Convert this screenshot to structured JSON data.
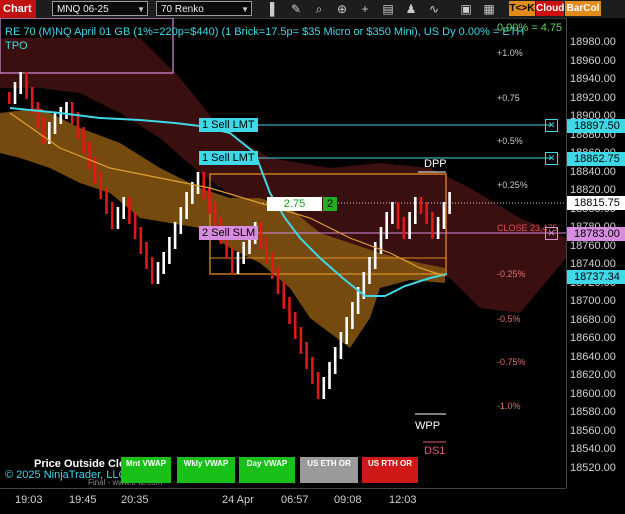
{
  "toolbar": {
    "chart_tab": "Chart",
    "instrument": "MNQ 06-25",
    "bar_type": "70 Renko",
    "icons": [
      "bar-style-icon",
      "draw-icon",
      "zoom-icon",
      "crosshair-icon",
      "add-icon",
      "properties-icon",
      "strategies-icon",
      "indicators-icon",
      "templates-icon",
      "data-box-icon"
    ],
    "tk_label": "T<>K",
    "cloud_label": "Cloud",
    "barcol_label": "BarCol"
  },
  "header": {
    "title": "RE 70 (M)NQ April 01 GB (1%=220p=$440) (1 Brick=17.5p= $35 Micro or $350 Mini), US Dy 0.00% = ETH",
    "tpo": "TPO"
  },
  "percent_labels": [
    {
      "text": "+1.0%",
      "color": "#c8c8c8"
    },
    {
      "text": "+0.75",
      "color": "#c8c8c8"
    },
    {
      "text": "+0.5%",
      "color": "#c8c8c8"
    },
    {
      "text": "+0.25%",
      "color": "#c8c8c8"
    },
    {
      "text": "-0.25%",
      "color": "#e07070"
    },
    {
      "text": "-0.5%",
      "color": "#e07070"
    },
    {
      "text": "-0.75%",
      "color": "#e07070"
    },
    {
      "text": "-1.0%",
      "color": "#e07070"
    }
  ],
  "zero_pct_label": "0.00% = 4.75",
  "close_label": "CLOSE 23,475",
  "orders": [
    {
      "label": "1 Sell LMT",
      "price": "18897.50"
    },
    {
      "label": "1 Sell LMT",
      "price": "18862.75"
    },
    {
      "label": "2 Sell SLM",
      "price": "18783.00"
    }
  ],
  "position": {
    "pnl": "2.75",
    "qty": "2"
  },
  "markers": {
    "dpp": "DPP",
    "wpp": "WPP",
    "ds1": "DS1"
  },
  "price_axis": {
    "ticks": [
      "18980.00",
      "18960.00",
      "18940.00",
      "18920.00",
      "18900.00",
      "18880.00",
      "18860.00",
      "18840.00",
      "18820.00",
      "18800.00",
      "18780.00",
      "18760.00",
      "18740.00",
      "18720.00",
      "18700.00",
      "18680.00",
      "18660.00",
      "18640.00",
      "18620.00",
      "18600.00",
      "18580.00",
      "18560.00",
      "18540.00",
      "18520.00"
    ],
    "last_price": "18815.75",
    "other_flag": "18737.34"
  },
  "time_axis": [
    "19:03",
    "19:45",
    "20:35",
    "24 Apr",
    "06:57",
    "09:08",
    "12:03"
  ],
  "footer": {
    "outside_label": "Price Outside Clo",
    "copyright": "© 2025 NinjaTrader, LLC",
    "watermark": "Final - www.tf-ai.com",
    "buttons": [
      {
        "line1": "Mnt VWAP",
        "color": "#18c018"
      },
      {
        "line1": "Wkly VWAP",
        "color": "#18c018"
      },
      {
        "line1": "Day VWAP",
        "color": "#18c018"
      },
      {
        "line1": "US ETH OR",
        "color": "#9a9a9a"
      },
      {
        "line1": "US RTH OR",
        "color": "#d01818"
      }
    ]
  },
  "colors": {
    "accent_cyan": "#3fd8e6",
    "bull_brick": "#ffffff",
    "bear_brick": "#e01818",
    "cloud_bear": "#3a1010",
    "cloud_bull": "#8a5a12",
    "magenta": "#d88ce0"
  }
}
